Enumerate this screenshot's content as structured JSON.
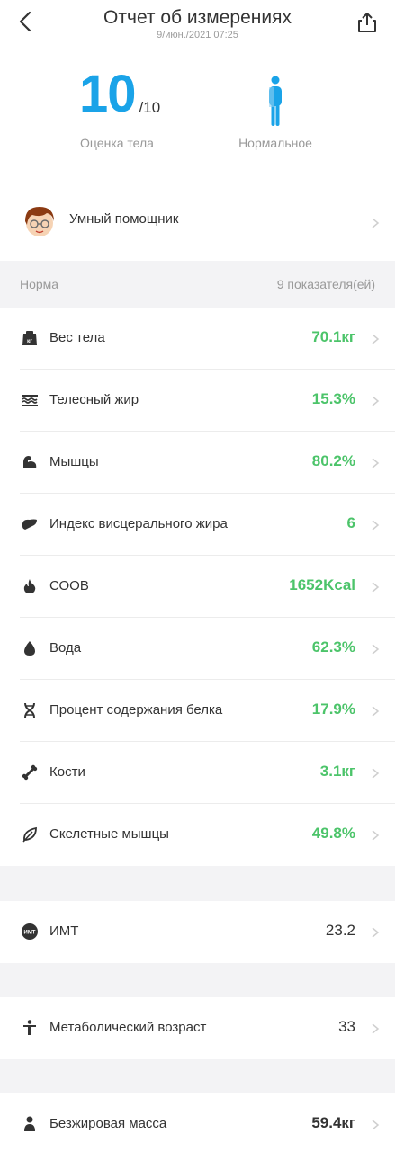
{
  "header": {
    "title": "Отчет об измерениях",
    "datetime": "9/июн./2021 07:25"
  },
  "summary": {
    "score": "10",
    "score_max": "/10",
    "score_label": "Оценка тела",
    "body_type_label": "Нормальное",
    "accent_color": "#1aa3e8"
  },
  "assistant": {
    "label": "Умный помощник"
  },
  "section": {
    "status": "Норма",
    "count": "9 показателя(ей)"
  },
  "metrics": [
    {
      "icon": "scale-icon",
      "label": "Вес тела",
      "value": "70.1кг"
    },
    {
      "icon": "body-fat-icon",
      "label": "Телесный жир",
      "value": "15.3%"
    },
    {
      "icon": "muscle-icon",
      "label": "Мышцы",
      "value": "80.2%"
    },
    {
      "icon": "liver-icon",
      "label": "Индекс висцерального жира",
      "value": "6"
    },
    {
      "icon": "flame-icon",
      "label": "СООВ",
      "value": "1652Kcal"
    },
    {
      "icon": "water-drop-icon",
      "label": "Вода",
      "value": "62.3%"
    },
    {
      "icon": "dna-icon",
      "label": "Процент содержания белка",
      "value": "17.9%"
    },
    {
      "icon": "bone-icon",
      "label": "Кости",
      "value": "3.1кг"
    },
    {
      "icon": "leaf-icon",
      "label": "Скелетные мышцы",
      "value": "49.8%"
    }
  ],
  "extra": [
    {
      "icon": "bmi-icon",
      "badge": "ИМТ",
      "label": "ИМТ",
      "value": "23.2"
    },
    {
      "icon": "person-icon",
      "label": "Метаболический возраст",
      "value": "33"
    },
    {
      "icon": "lean-mass-icon",
      "label": "Безжировая масса",
      "value": "59.4кг"
    }
  ],
  "colors": {
    "good": "#4cc46a",
    "text": "#333333",
    "muted": "#9a9a9a",
    "band": "#f3f3f5"
  }
}
